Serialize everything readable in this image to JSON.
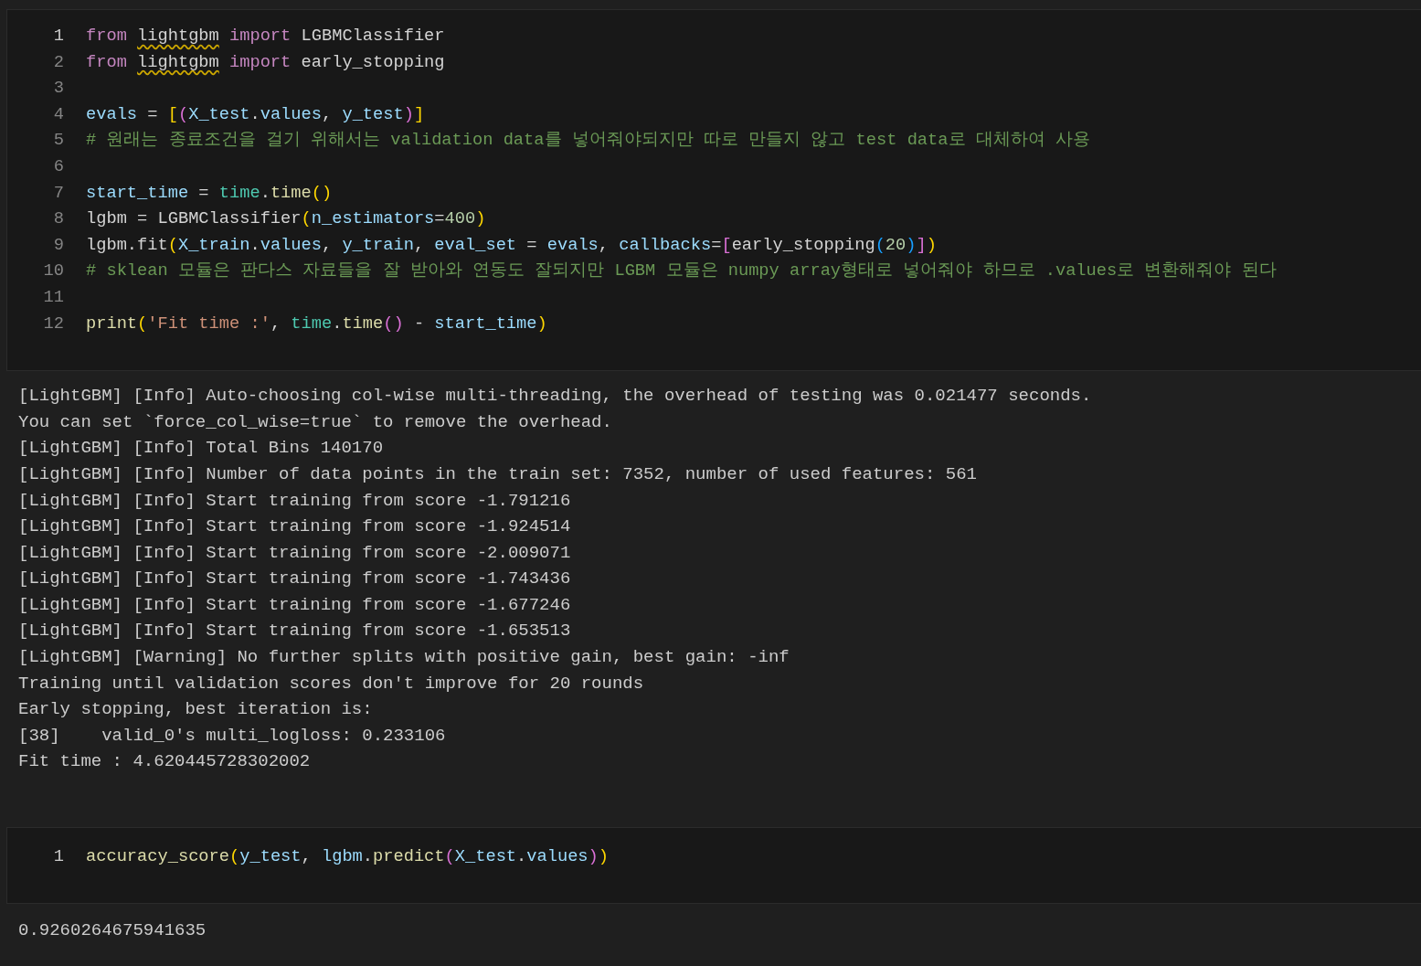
{
  "cells": [
    {
      "lines": [
        {
          "number": "1",
          "current": true,
          "tokens": [
            {
              "kind": "keyword",
              "text": "from "
            },
            {
              "kind": "unresolved",
              "text": "lightgbm"
            },
            {
              "kind": "keyword",
              "text": " import"
            },
            {
              "kind": "plain",
              "text": " LGBMClassifier"
            }
          ]
        },
        {
          "number": "2",
          "current": false,
          "tokens": [
            {
              "kind": "keyword",
              "text": "from "
            },
            {
              "kind": "unresolved",
              "text": "lightgbm"
            },
            {
              "kind": "keyword",
              "text": " import"
            },
            {
              "kind": "plain",
              "text": " early_stopping"
            }
          ]
        },
        {
          "number": "3",
          "current": false
        },
        {
          "number": "4",
          "current": false,
          "tokens": [
            {
              "kind": "variable",
              "text": "evals"
            },
            {
              "kind": "plain",
              "text": " = "
            },
            {
              "kind": "bracket1",
              "text": "["
            },
            {
              "kind": "bracket2",
              "text": "("
            },
            {
              "kind": "variable",
              "text": "X_test"
            },
            {
              "kind": "plain",
              "text": "."
            },
            {
              "kind": "variable",
              "text": "values"
            },
            {
              "kind": "plain",
              "text": ", "
            },
            {
              "kind": "variable",
              "text": "y_test"
            },
            {
              "kind": "bracket2",
              "text": ")"
            },
            {
              "kind": "bracket1",
              "text": "]"
            }
          ]
        },
        {
          "number": "5",
          "current": false,
          "tokens": [
            {
              "kind": "comment",
              "text": "# 원래는 종료조건을 걸기 위해서는 validation data를 넣어줘야되지만 따로 만들지 않고 test data로 대체하여 사용"
            }
          ]
        },
        {
          "number": "6",
          "current": false
        },
        {
          "number": "7",
          "current": false,
          "tokens": [
            {
              "kind": "variable",
              "text": "start_time"
            },
            {
              "kind": "plain",
              "text": " = "
            },
            {
              "kind": "class",
              "text": "time"
            },
            {
              "kind": "plain",
              "text": "."
            },
            {
              "kind": "function",
              "text": "time"
            },
            {
              "kind": "bracket1",
              "text": "()"
            }
          ]
        },
        {
          "number": "8",
          "current": false,
          "tokens": [
            {
              "kind": "plain",
              "text": "lgbm = LGBMClassifier"
            },
            {
              "kind": "bracket1",
              "text": "("
            },
            {
              "kind": "variable",
              "text": "n_estimators"
            },
            {
              "kind": "plain",
              "text": "="
            },
            {
              "kind": "number",
              "text": "400"
            },
            {
              "kind": "bracket1",
              "text": ")"
            }
          ]
        },
        {
          "number": "9",
          "current": false,
          "tokens": [
            {
              "kind": "plain",
              "text": "lgbm.fit"
            },
            {
              "kind": "bracket1",
              "text": "("
            },
            {
              "kind": "variable",
              "text": "X_train"
            },
            {
              "kind": "plain",
              "text": "."
            },
            {
              "kind": "variable",
              "text": "values"
            },
            {
              "kind": "plain",
              "text": ", "
            },
            {
              "kind": "variable",
              "text": "y_train"
            },
            {
              "kind": "plain",
              "text": ", "
            },
            {
              "kind": "variable",
              "text": "eval_set"
            },
            {
              "kind": "plain",
              "text": " = "
            },
            {
              "kind": "variable",
              "text": "evals"
            },
            {
              "kind": "plain",
              "text": ", "
            },
            {
              "kind": "variable",
              "text": "callbacks"
            },
            {
              "kind": "plain",
              "text": "="
            },
            {
              "kind": "bracket2",
              "text": "["
            },
            {
              "kind": "plain",
              "text": "early_stopping"
            },
            {
              "kind": "bracket3",
              "text": "("
            },
            {
              "kind": "number",
              "text": "20"
            },
            {
              "kind": "bracket3",
              "text": ")"
            },
            {
              "kind": "bracket2",
              "text": "]"
            },
            {
              "kind": "bracket1",
              "text": ")"
            }
          ]
        },
        {
          "number": "10",
          "current": false,
          "tokens": [
            {
              "kind": "comment",
              "text": "# sklean 모듈은 판다스 자료들을 잘 받아와 연동도 잘되지만 LGBM 모듈은 numpy array형태로 넣어줘야 하므로 .values로 변환해줘야 된다"
            }
          ]
        },
        {
          "number": "11",
          "current": false
        },
        {
          "number": "12",
          "current": false,
          "tokens": [
            {
              "kind": "function",
              "text": "print"
            },
            {
              "kind": "bracket1",
              "text": "("
            },
            {
              "kind": "string",
              "text": "'Fit time :'"
            },
            {
              "kind": "plain",
              "text": ", "
            },
            {
              "kind": "class",
              "text": "time"
            },
            {
              "kind": "plain",
              "text": "."
            },
            {
              "kind": "function",
              "text": "time"
            },
            {
              "kind": "bracket2",
              "text": "()"
            },
            {
              "kind": "plain",
              "text": " - "
            },
            {
              "kind": "variable",
              "text": "start_time"
            },
            {
              "kind": "bracket1",
              "text": ")"
            }
          ]
        }
      ],
      "output": [
        "[LightGBM] [Info] Auto-choosing col-wise multi-threading, the overhead of testing was 0.021477 seconds.",
        "You can set `force_col_wise=true` to remove the overhead.",
        "[LightGBM] [Info] Total Bins 140170",
        "[LightGBM] [Info] Number of data points in the train set: 7352, number of used features: 561",
        "[LightGBM] [Info] Start training from score -1.791216",
        "[LightGBM] [Info] Start training from score -1.924514",
        "[LightGBM] [Info] Start training from score -2.009071",
        "[LightGBM] [Info] Start training from score -1.743436",
        "[LightGBM] [Info] Start training from score -1.677246",
        "[LightGBM] [Info] Start training from score -1.653513",
        "[LightGBM] [Warning] No further splits with positive gain, best gain: -inf",
        "Training until validation scores don't improve for 20 rounds",
        "Early stopping, best iteration is:",
        "[38]    valid_0's multi_logloss: 0.233106",
        "Fit time : 4.620445728302002"
      ]
    },
    {
      "lines": [
        {
          "number": "1",
          "current": true,
          "tokens": [
            {
              "kind": "function",
              "text": "accuracy_score"
            },
            {
              "kind": "bracket1",
              "text": "("
            },
            {
              "kind": "variable",
              "text": "y_test"
            },
            {
              "kind": "plain",
              "text": ", "
            },
            {
              "kind": "variable",
              "text": "lgbm"
            },
            {
              "kind": "plain",
              "text": "."
            },
            {
              "kind": "function",
              "text": "predict"
            },
            {
              "kind": "bracket2",
              "text": "("
            },
            {
              "kind": "variable",
              "text": "X_test"
            },
            {
              "kind": "plain",
              "text": "."
            },
            {
              "kind": "variable",
              "text": "values"
            },
            {
              "kind": "bracket2",
              "text": ")"
            },
            {
              "kind": "bracket1",
              "text": ")"
            }
          ]
        }
      ],
      "output": [
        "0.9260264675941635"
      ]
    }
  ]
}
